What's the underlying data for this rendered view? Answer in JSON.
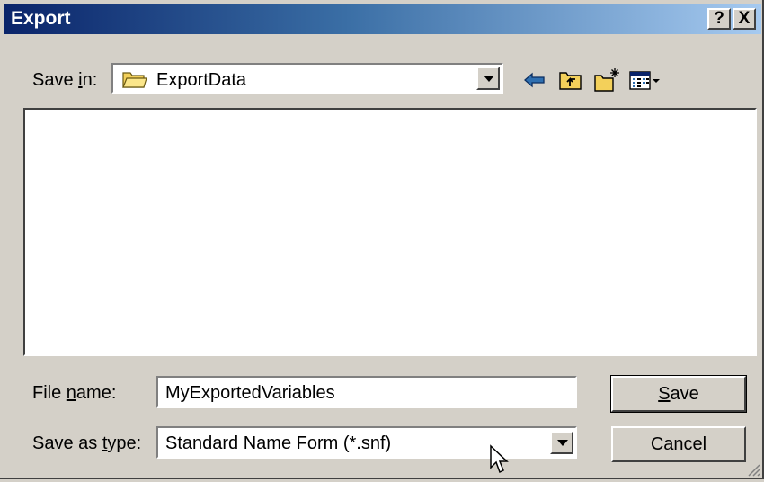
{
  "window": {
    "title": "Export",
    "help_label": "?",
    "close_label": "X"
  },
  "save_in": {
    "label_pre": "Save ",
    "label_key": "i",
    "label_post": "n:",
    "value": "ExportData"
  },
  "toolbar": {
    "icons": [
      "back-icon",
      "up-folder-icon",
      "new-folder-icon",
      "view-menu-icon"
    ]
  },
  "file_name": {
    "label_pre": "File ",
    "label_key": "n",
    "label_post": "ame:",
    "value": "MyExportedVariables"
  },
  "save_as_type": {
    "label_pre": "Save as ",
    "label_key": "t",
    "label_post": "ype:",
    "value": "Standard Name Form (*.snf)"
  },
  "buttons": {
    "save_key": "S",
    "save_rest": "ave",
    "cancel": "Cancel"
  },
  "colors": {
    "title_start": "#0a246a",
    "title_end": "#a6caf0",
    "face": "#d4d0c8"
  }
}
